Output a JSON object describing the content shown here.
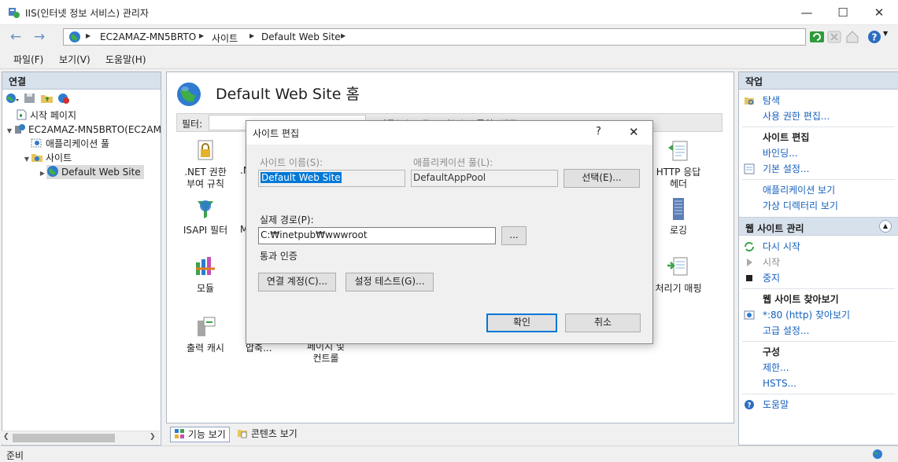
{
  "window": {
    "title": "IIS(인터넷 정보 서비스) 관리자",
    "icons": [
      "iis-manager-icon",
      "minimize-icon",
      "maximize-icon",
      "close-icon"
    ]
  },
  "address": {
    "crumbs": [
      "EC2AMAZ-MN5BRTO",
      "사이트",
      "Default Web Site"
    ],
    "icons": [
      "back-arrow-icon",
      "forward-arrow-icon",
      "globe-icon",
      "refresh-icon",
      "stop-icon",
      "home-icon",
      "help-icon"
    ]
  },
  "menu": {
    "file": "파일(F)",
    "view": "보기(V)",
    "help": "도움말(H)"
  },
  "left": {
    "header": "연결",
    "tree": [
      {
        "label": "시작 페이지",
        "icon": "start-page-icon"
      },
      {
        "label": "EC2AMAZ-MN5BRTO(EC2AM",
        "icon": "server-icon"
      },
      {
        "label": "애플리케이션 풀",
        "icon": "app-pool-icon"
      },
      {
        "label": "사이트",
        "icon": "sites-folder-icon"
      },
      {
        "label": "Default Web Site",
        "icon": "globe-icon"
      }
    ]
  },
  "center": {
    "title": "Default Web Site 홈",
    "filter_label": "필터:",
    "features": {
      "net_auth": ".NET 권한\n부여 규칙",
      "net_auth_clip": ".N",
      "isapi": "ISAPI 필터",
      "isapi_clip": "M",
      "modules": "모듈",
      "output_cache": "출력 캐시",
      "compression_clip": "압축...",
      "error_pages_clip": "페이지 및\n컨트롤",
      "http_headers": "HTTP 응답\n헤더",
      "logging": "로깅",
      "handler_mapping": "처리기 매핑"
    },
    "filterbar_hidden_text": "이동(G)    모두 표시(A)  그룹화: 범주"
  },
  "tabs": {
    "features_view": "기능 보기",
    "content_view": "콘텐츠 보기"
  },
  "status": {
    "text": "준비"
  },
  "right": {
    "header": "작업",
    "explore": "탐색",
    "edit_permissions": "사용 권한 편집...",
    "edit_site_group": "사이트 편집",
    "bindings": "바인딩...",
    "basic_settings": "기본 설정...",
    "view_apps": "애플리케이션 보기",
    "view_vdirs": "가상 디렉터리 보기",
    "manage_site": "웹 사이트 관리",
    "restart": "다시 시작",
    "start": "시작",
    "stop": "중지",
    "browse_group": "웹 사이트 찾아보기",
    "browse_80": "*:80 (http) 찾아보기",
    "advanced": "고급 설정...",
    "config_group": "구성",
    "limits": "제한...",
    "hsts": "HSTS...",
    "help": "도움말"
  },
  "dialog": {
    "title": "사이트 편집",
    "help_glyph": "?",
    "site_name_label": "사이트 이름(S):",
    "site_name_value": "Default Web Site",
    "app_pool_label": "애플리케이션 풀(L):",
    "app_pool_value": "DefaultAppPool",
    "select_button": "선택(E)...",
    "physical_path_label": "실제 경로(P):",
    "physical_path_value": "C:₩inetpub₩wwwroot",
    "browse_button": "...",
    "passthrough_label": "통과 인증",
    "connect_as_button": "연결 계정(C)...",
    "test_settings_button": "설정 테스트(G)...",
    "ok_button": "확인",
    "cancel_button": "취소"
  }
}
